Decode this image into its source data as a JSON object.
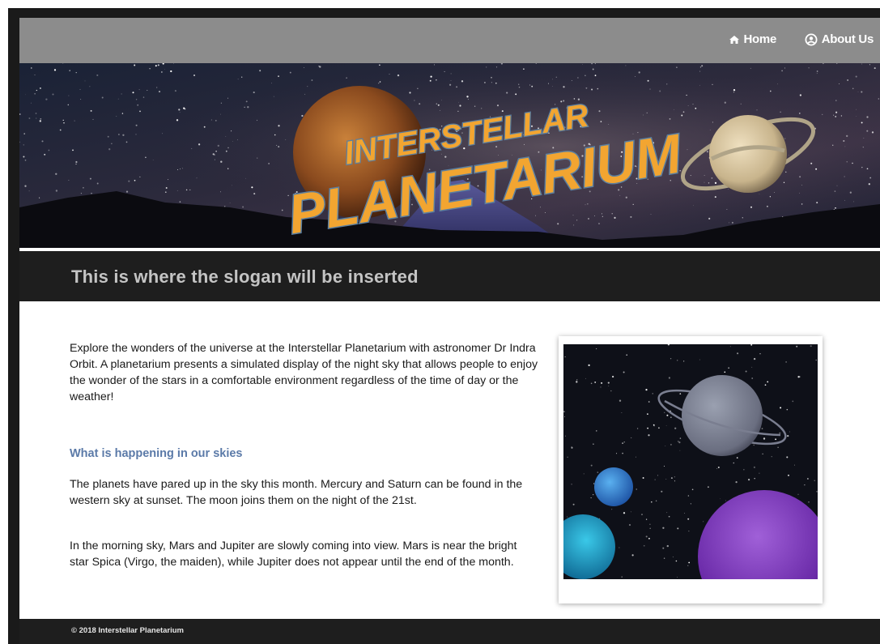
{
  "nav": {
    "home_label": "Home",
    "about_label": "About Us",
    "home_icon": "home-icon",
    "about_icon": "user-circle-icon"
  },
  "banner": {
    "logo_line1": "INTERSTELLAR",
    "logo_line2": "PLANETARIUM"
  },
  "slogan": "This is where the slogan will be inserted",
  "main": {
    "intro": "Explore the wonders of the universe at the Interstellar Planetarium with astronomer Dr Indra Orbit. A planetarium presents a simulated display of the night sky that allows people to enjoy the wonder of the stars in a comfortable environment regardless of the time of day or the weather!",
    "section_heading": "What is happening in our skies",
    "para1": "The planets have pared up in the sky this month. Mercury and Saturn can be found in the western sky at sunset. The moon joins them on the night of the 21st.",
    "para2": "In the morning sky, Mars and Jupiter are slowly coming into view. Mars is near the bright star Spica (Virgo, the maiden), while Jupiter does not appear until the end of the month."
  },
  "footer": {
    "copyright": "© 2018 Interstellar Planetarium"
  },
  "colors": {
    "nav_bg": "#8c8c8c",
    "slogan_bar": "#1e1e1e",
    "slogan_text": "#c4c4c4",
    "heading_blue": "#5b7aa8",
    "logo_orange": "#f2a531",
    "logo_outline": "#5b7fa0"
  }
}
